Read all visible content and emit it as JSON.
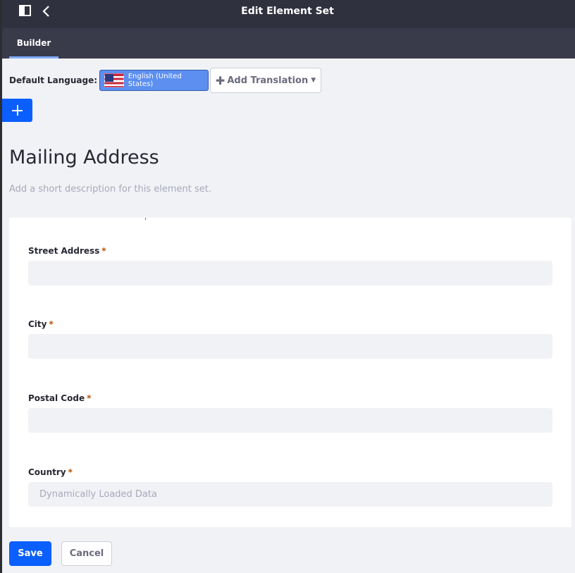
{
  "header": {
    "title": "Edit Element Set",
    "sidebar_icon": "sidebar-toggle-icon",
    "back_icon": "chevron-left-icon"
  },
  "tabs": [
    {
      "label": "Builder",
      "active": true
    }
  ],
  "language": {
    "label": "Default Language:",
    "current": "English (United States)",
    "flag_icon": "us-flag-icon",
    "add_translation": "Add Translation"
  },
  "element_set": {
    "title": "Mailing Address",
    "description_placeholder": "Add a short description for this element set."
  },
  "fields": [
    {
      "label": "Street Address",
      "required_mark": "*",
      "value": "",
      "placeholder": ""
    },
    {
      "label": "City",
      "required_mark": "*",
      "value": "",
      "placeholder": ""
    },
    {
      "label": "Postal Code",
      "required_mark": "*",
      "value": "",
      "placeholder": ""
    },
    {
      "label": "Country",
      "required_mark": "*",
      "value": "",
      "placeholder": "Dynamically Loaded Data"
    }
  ],
  "actions": {
    "save": "Save",
    "cancel": "Cancel"
  },
  "colors": {
    "primary": "#0b5fff",
    "topbar": "#30313f",
    "tabbar": "#393a4a",
    "required": "#b95000"
  }
}
